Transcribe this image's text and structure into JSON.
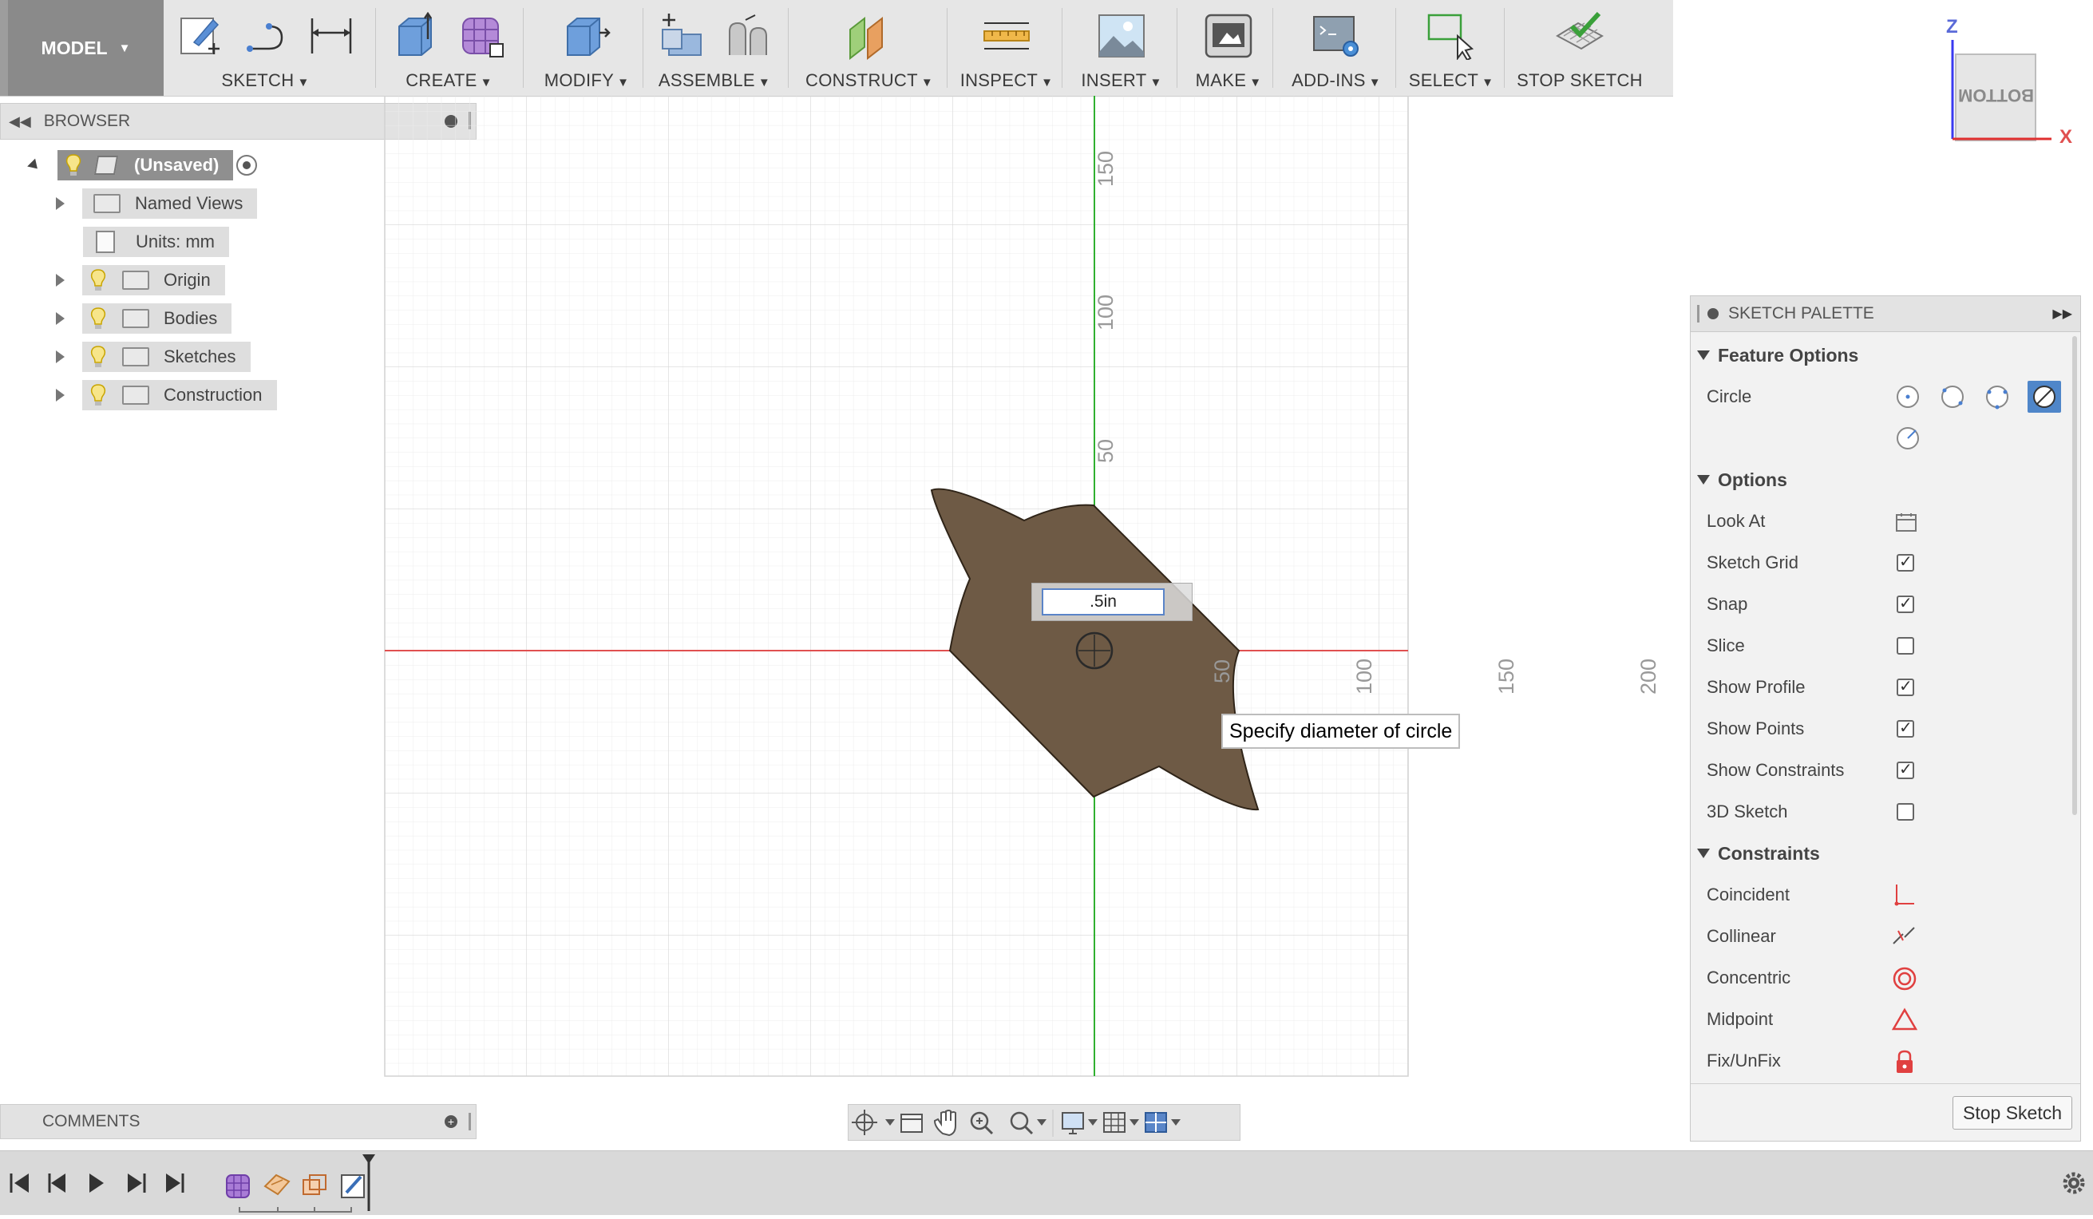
{
  "toolbar": {
    "model_label": "MODEL",
    "groups": {
      "sketch": "SKETCH",
      "create": "CREATE",
      "modify": "MODIFY",
      "assemble": "ASSEMBLE",
      "construct": "CONSTRUCT",
      "inspect": "INSPECT",
      "insert": "INSERT",
      "make": "MAKE",
      "addins": "ADD-INS",
      "select": "SELECT",
      "stop_sketch": "STOP SKETCH"
    }
  },
  "browser": {
    "title": "BROWSER",
    "items": [
      {
        "label": "(Unsaved)"
      },
      {
        "label": "Named Views"
      },
      {
        "label": "Units: mm"
      },
      {
        "label": "Origin"
      },
      {
        "label": "Bodies"
      },
      {
        "label": "Sketches"
      },
      {
        "label": "Construction"
      }
    ]
  },
  "viewcube": {
    "face_label": "BOTTOM",
    "axis_z": "Z",
    "axis_x": "X"
  },
  "canvas": {
    "ruler_labels": [
      "150",
      "100",
      "50",
      "50",
      "100",
      "150",
      "200"
    ],
    "dimension_value": ".5in",
    "tooltip": "Specify diameter of circle",
    "profile_color": "#6e5a45"
  },
  "palette": {
    "title": "SKETCH PALETTE",
    "feature_options": {
      "title": "Feature Options",
      "circle_label": "Circle"
    },
    "options": {
      "title": "Options",
      "look_at": "Look At",
      "items": [
        {
          "label": "Sketch Grid",
          "checked": true
        },
        {
          "label": "Snap",
          "checked": true
        },
        {
          "label": "Slice",
          "checked": false
        },
        {
          "label": "Show Profile",
          "checked": true
        },
        {
          "label": "Show Points",
          "checked": true
        },
        {
          "label": "Show Constraints",
          "checked": true
        },
        {
          "label": "3D Sketch",
          "checked": false
        }
      ]
    },
    "constraints": {
      "title": "Constraints",
      "items": [
        {
          "label": "Coincident",
          "icon": "coincident-icon"
        },
        {
          "label": "Collinear",
          "icon": "collinear-icon"
        },
        {
          "label": "Concentric",
          "icon": "concentric-icon"
        },
        {
          "label": "Midpoint",
          "icon": "midpoint-icon"
        },
        {
          "label": "Fix/UnFix",
          "icon": "lock-icon"
        }
      ]
    },
    "stop_button": "Stop Sketch"
  },
  "comments": {
    "title": "COMMENTS"
  }
}
